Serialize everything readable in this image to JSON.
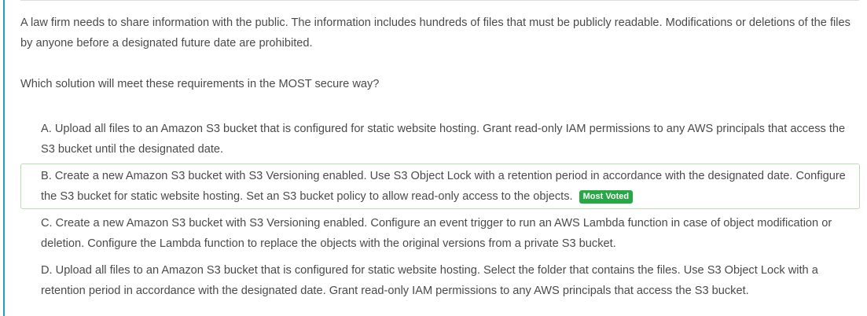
{
  "question": {
    "text": "A law firm needs to share information with the public. The information includes hundreds of files that must be publicly readable. Modifications or deletions of the files by anyone before a designated future date are prohibited.",
    "prompt": "Which solution will meet these requirements in the MOST secure way?"
  },
  "choices": [
    {
      "text": "A. Upload all files to an Amazon S3 bucket that is configured for static website hosting. Grant read-only IAM permissions to any AWS principals that access the S3 bucket until the designated date."
    },
    {
      "text": "B. Create a new Amazon S3 bucket with S3 Versioning enabled. Use S3 Object Lock with a retention period in accordance with the designated date. Configure the S3 bucket for static website hosting. Set an S3 bucket policy to allow read-only access to the objects.",
      "badge": "Most Voted"
    },
    {
      "text": "C. Create a new Amazon S3 bucket with S3 Versioning enabled. Configure an event trigger to run an AWS Lambda function in case of object modification or deletion. Configure the Lambda function to replace the objects with the original versions from a private S3 bucket."
    },
    {
      "text": "D. Upload all files to an Amazon S3 bucket that is configured for static website hosting. Select the folder that contains the files. Use S3 Object Lock with a retention period in accordance with the designated date. Grant read-only IAM permissions to any AWS principals that access the S3 bucket."
    }
  ],
  "colors": {
    "accent_rule": "#1fa3b8",
    "badge_bg": "#28a745",
    "voted_border": "#b9e0b3"
  }
}
